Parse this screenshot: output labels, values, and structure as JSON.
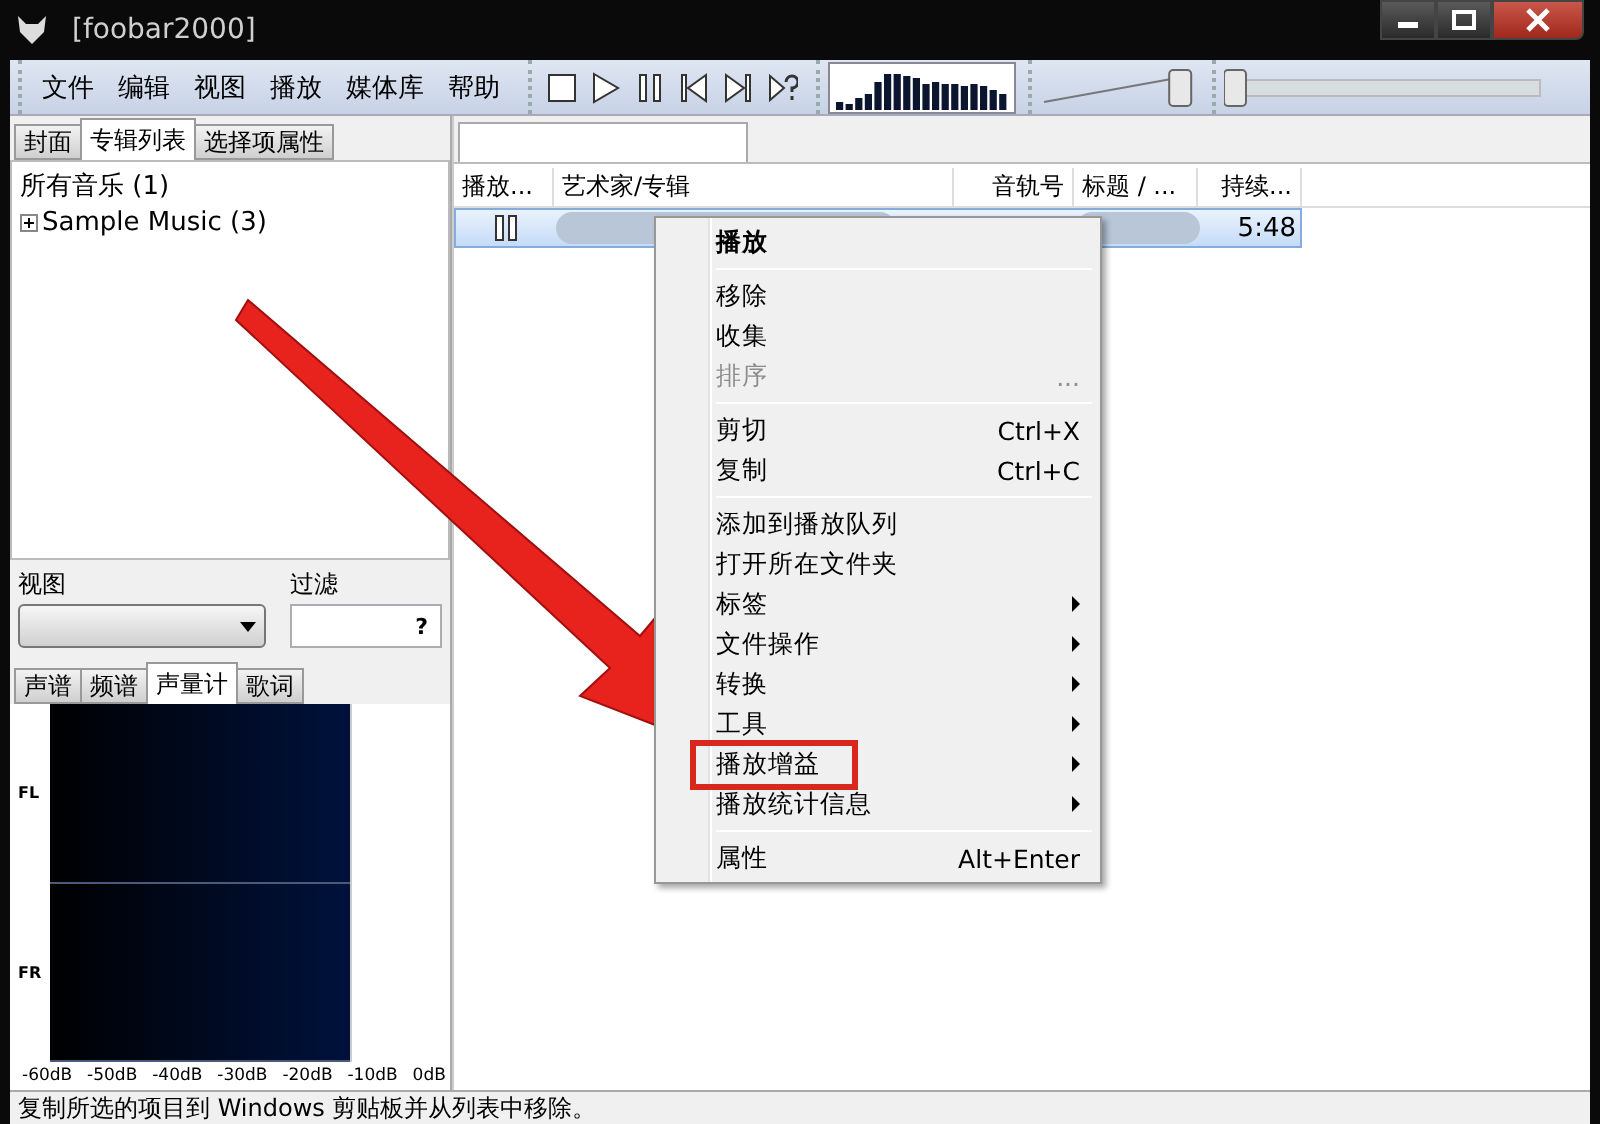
{
  "window": {
    "title": "[foobar2000]"
  },
  "menubar": [
    "文件",
    "编辑",
    "视图",
    "播放",
    "媒体库",
    "帮助"
  ],
  "volume": {
    "level": 0.95
  },
  "seek": {
    "level": 0
  },
  "left_tabs": [
    {
      "label": "封面",
      "selected": false
    },
    {
      "label": "专辑列表",
      "selected": true
    },
    {
      "label": "选择项属性",
      "selected": false
    }
  ],
  "tree": [
    {
      "label": "所有音乐 (1)",
      "children": [
        {
          "label": "Sample Music (3)",
          "expanded": false
        }
      ]
    }
  ],
  "view_label": "视图",
  "filter": {
    "label": "过滤",
    "button": "?"
  },
  "vis_tabs": [
    {
      "label": "声谱",
      "selected": false
    },
    {
      "label": "频谱",
      "selected": false
    },
    {
      "label": "声量计",
      "selected": true
    },
    {
      "label": "歌词",
      "selected": false
    }
  ],
  "meter": {
    "channels": [
      "FL",
      "FR"
    ],
    "scale": [
      "-60dB",
      "-50dB",
      "-40dB",
      "-30dB",
      "-20dB",
      "-10dB",
      "0dB"
    ]
  },
  "playlist": {
    "columns": [
      "播放...",
      "艺术家/专辑",
      "音轨号",
      "标题 / ...",
      "持续..."
    ],
    "rows": [
      {
        "playing": true,
        "selected": true,
        "duration": "5:48"
      }
    ]
  },
  "context_menu": [
    {
      "kind": "item",
      "label": "播放",
      "default": true
    },
    {
      "kind": "separator"
    },
    {
      "kind": "item",
      "label": "移除"
    },
    {
      "kind": "item",
      "label": "收集"
    },
    {
      "kind": "item",
      "label": "排序",
      "shortcut": "...",
      "disabled": true
    },
    {
      "kind": "separator"
    },
    {
      "kind": "item",
      "label": "剪切",
      "shortcut": "Ctrl+X"
    },
    {
      "kind": "item",
      "label": "复制",
      "shortcut": "Ctrl+C"
    },
    {
      "kind": "separator"
    },
    {
      "kind": "item",
      "label": "添加到播放队列"
    },
    {
      "kind": "item",
      "label": "打开所在文件夹"
    },
    {
      "kind": "item",
      "label": "标签",
      "submenu": true
    },
    {
      "kind": "item",
      "label": "文件操作",
      "submenu": true
    },
    {
      "kind": "item",
      "label": "转换",
      "submenu": true
    },
    {
      "kind": "item",
      "label": "工具",
      "submenu": true
    },
    {
      "kind": "item",
      "label": "播放增益",
      "submenu": true,
      "highlighted": true
    },
    {
      "kind": "item",
      "label": "播放统计信息",
      "submenu": true
    },
    {
      "kind": "separator"
    },
    {
      "kind": "item",
      "label": "属性",
      "shortcut": "Alt+Enter"
    }
  ],
  "status_bar": "复制所选的项目到 Windows 剪贴板并从列表中移除。"
}
